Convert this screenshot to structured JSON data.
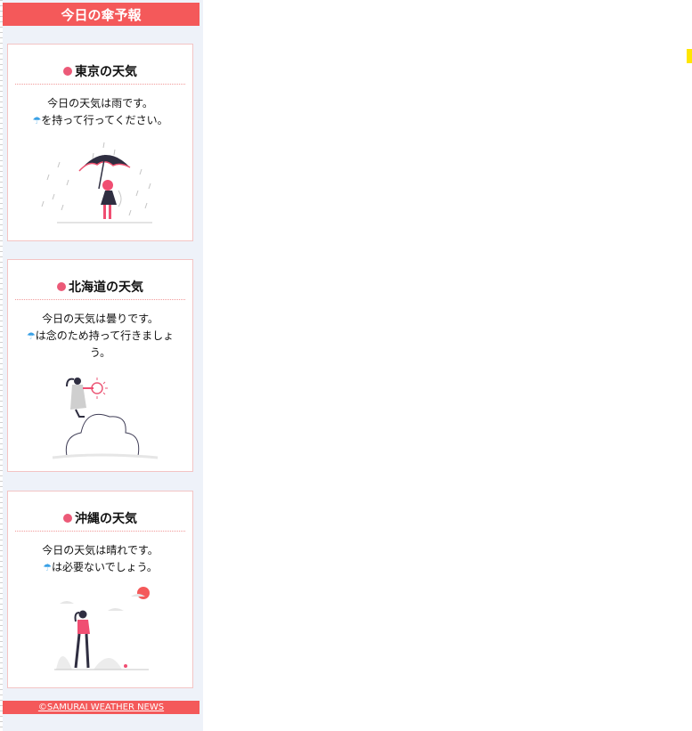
{
  "header": {
    "title": "今日の傘予報"
  },
  "cards": [
    {
      "title": "東京の天気",
      "line1": "今日の天気は雨です。",
      "umbrella_icon": "☂",
      "line2": "を持って行ってください。",
      "illustration": "person-with-umbrella-in-rain"
    },
    {
      "title": "北海道の天気",
      "line1": "今日の天気は曇りです。",
      "umbrella_icon": "☂",
      "line2": "は念のため持って行きましょう。",
      "illustration": "person-on-cloud-with-sun"
    },
    {
      "title": "沖縄の天気",
      "line1": "今日の天気は晴れです。",
      "umbrella_icon": "☂",
      "line2": "は必要ないでしょう。",
      "illustration": "person-walking-sunny"
    }
  ],
  "footer": {
    "link": "©SAMURAI WEATHER NEWS"
  },
  "colors": {
    "accent": "#f4595a",
    "card_border": "#f3c4c4",
    "title_dot": "#ec5a78",
    "umbrella_icon": "#3aa1e6",
    "page_bg": "#eef2f9"
  }
}
